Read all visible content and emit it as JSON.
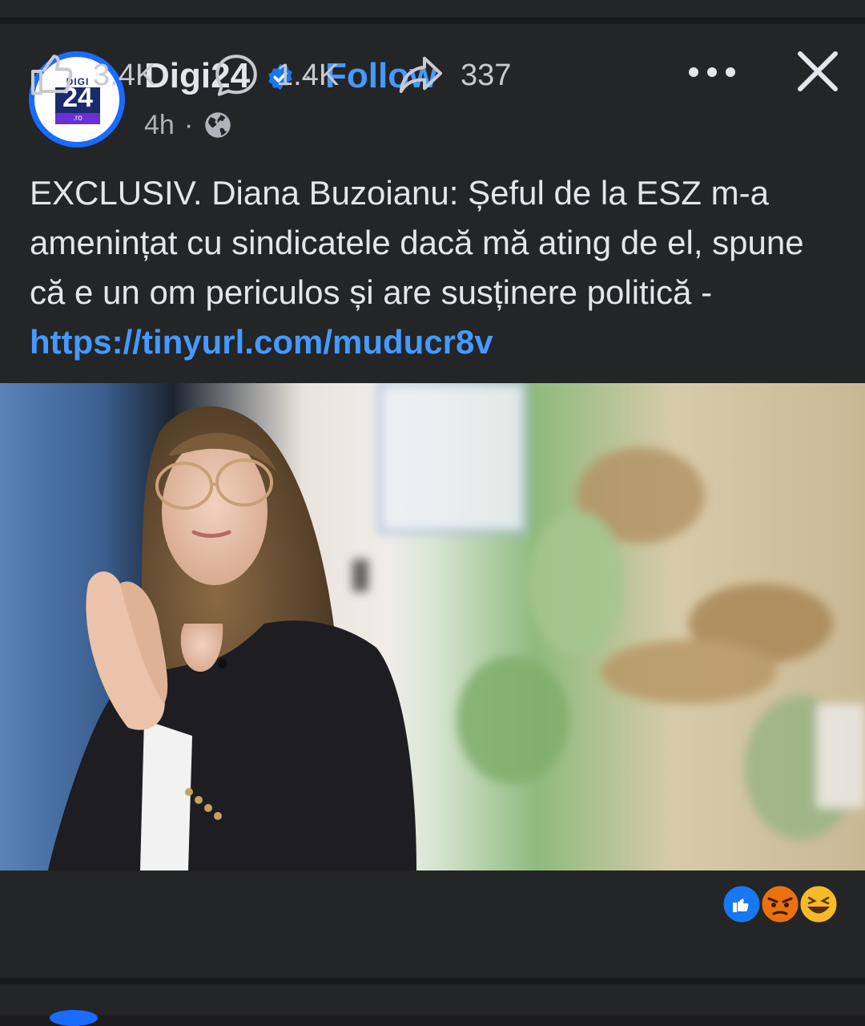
{
  "post": {
    "page_name": "Digi24",
    "follow_label": "Follow",
    "separator": "·",
    "time": "4h",
    "time_separator": "·",
    "logo": {
      "top": "DIGI",
      "number": "24",
      "suffix": ".ro"
    },
    "text": "EXCLUSIV. Diana Buzoianu: Șeful de la ESZ m-a amenințat cu sindicatele dacă mă ating de el, spune că e un om periculos și are susținere politică - ",
    "link": "https://tinyurl.com/muducr8v",
    "likes": "3.4K",
    "comments": "1.4K",
    "shares": "337",
    "reactions": [
      "like",
      "angry",
      "haha"
    ]
  },
  "colors": {
    "background": "#242526",
    "link": "#4599ff",
    "verified": "#1877f2"
  }
}
